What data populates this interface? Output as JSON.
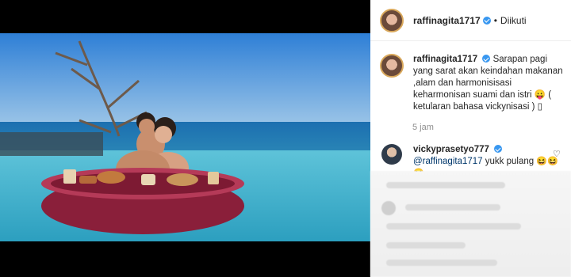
{
  "post": {
    "username": "raffinagita1717",
    "dot": "•",
    "follow_status": "Diikuti"
  },
  "caption": {
    "username": "raffinagita1717",
    "text": "Sarapan pagi yang sarat akan keindahan makanan ,alam dan harmonisisasi keharmonisan suami dan istri 😛 ( ketularan bahasa vickynisasi ) ▯",
    "time": "5 jam"
  },
  "comment": {
    "username": "vickyprasetyo777",
    "mention": "@raffinagita1717",
    "text": "yukk pulang",
    "emojis": "😆😆😆"
  },
  "icons": {
    "verified": "verified-badge-icon",
    "heart": "heart-icon"
  },
  "colors": {
    "verified": "#3897f0",
    "mention": "#00376b",
    "meta_text": "#8e8e8e"
  }
}
